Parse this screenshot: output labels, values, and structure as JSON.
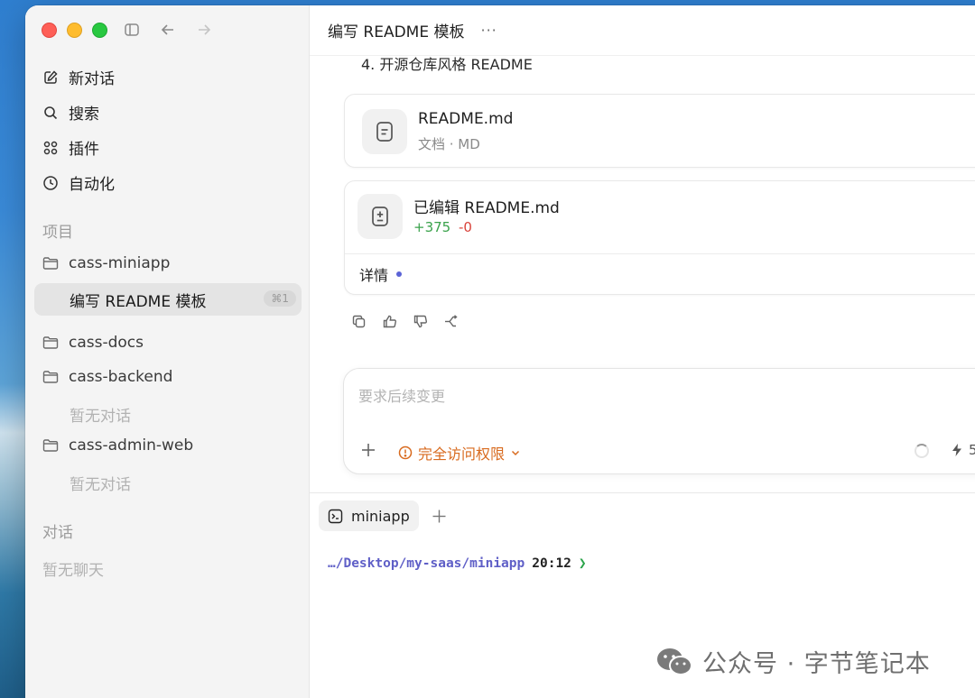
{
  "sidebar": {
    "nav": [
      {
        "label": "新对话",
        "icon": "edit-icon"
      },
      {
        "label": "搜索",
        "icon": "search-icon"
      },
      {
        "label": "插件",
        "icon": "plugins-icon"
      },
      {
        "label": "自动化",
        "icon": "clock-icon"
      }
    ],
    "projects_label": "项目",
    "projects": [
      {
        "name": "cass-miniapp"
      },
      {
        "name": "cass-docs"
      },
      {
        "name": "cass-backend"
      },
      {
        "name": "cass-admin-web"
      }
    ],
    "active_thread": {
      "label": "编写 README 模板",
      "shortcut": "⌘1"
    },
    "empty_threads": "暂无对话",
    "chats_label": "对话",
    "empty_chats": "暂无聊天"
  },
  "main": {
    "title": "编写 README 模板",
    "more": "···",
    "list_item": "4. 开源仓库风格 README",
    "file_card": {
      "name": "README.md",
      "meta": "文档 · MD"
    },
    "edit_card": {
      "title": "已编辑 README.md",
      "additions": "+375",
      "deletions": "-0",
      "details": "详情"
    },
    "composer": {
      "placeholder": "要求后续变更",
      "permission": "完全访问权限",
      "model_partial": "5"
    },
    "terminal": {
      "tab": "miniapp",
      "path": "…/Desktop/my-saas/miniapp",
      "time": "20:12",
      "caret": "❯"
    }
  },
  "watermark": "公众号 · 字节笔记本",
  "colors": {
    "accent_orange": "#d86a1e",
    "diff_plus": "#3aa24b",
    "diff_minus": "#d9433b",
    "prompt_path": "#5f5fc7"
  }
}
